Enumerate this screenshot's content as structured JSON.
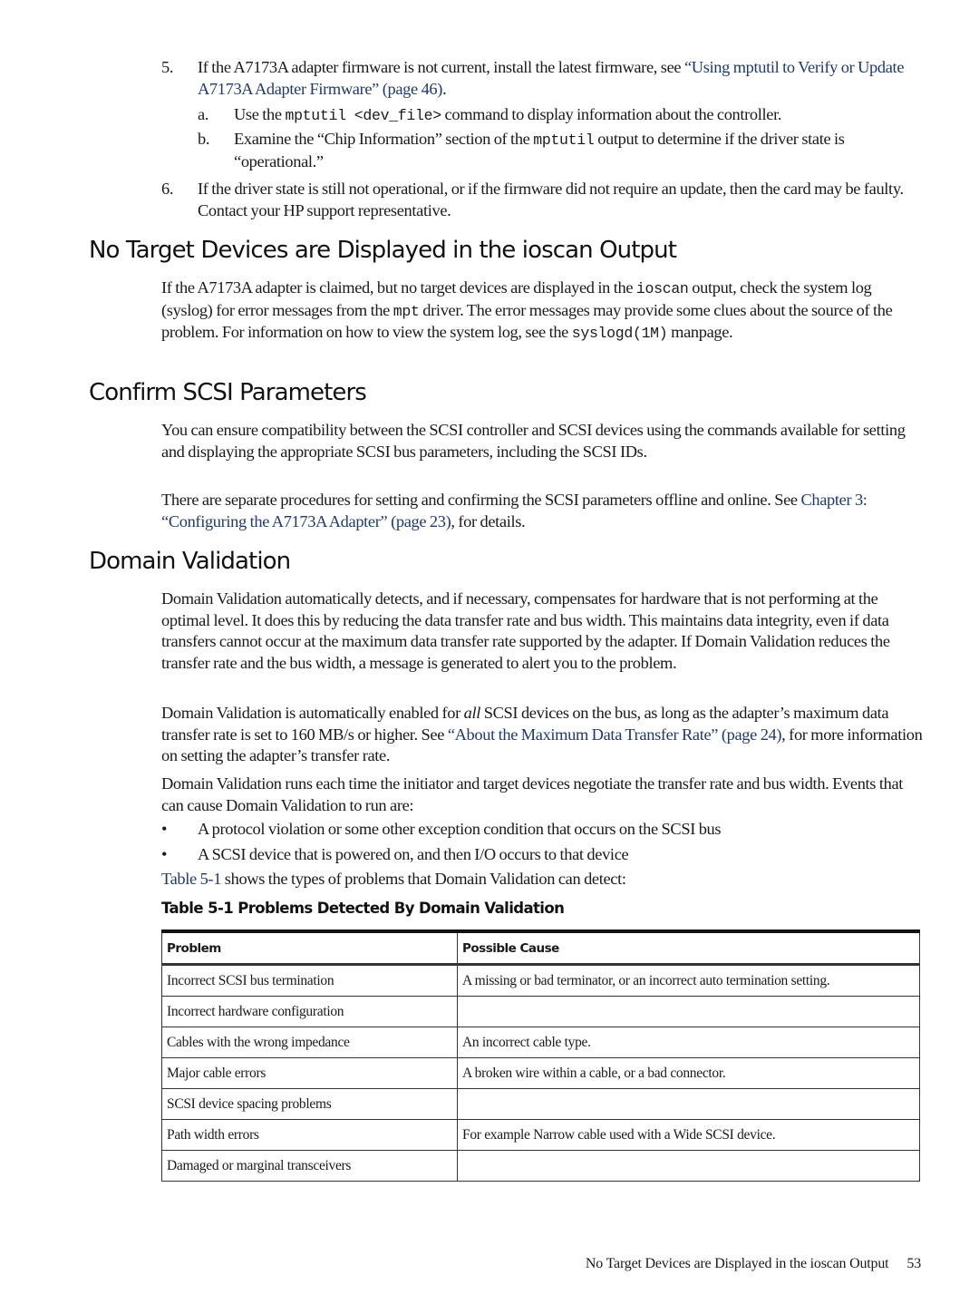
{
  "steps": [
    {
      "number": "5.",
      "text_before": "If the A7173A adapter firmware is not current, install the latest firmware, see ",
      "link": "“Using mptutil to Verify or Update A7173A Adapter Firmware” (page 46)",
      "text_after": ".",
      "substeps": [
        {
          "letter": "a.",
          "pre": "Use the ",
          "code": "mptutil <dev_file>",
          "post": " command to display information about the controller."
        },
        {
          "letter": "b.",
          "pre": "Examine the “Chip Information” section of the ",
          "code": "mptutil",
          "post": " output to determine if the driver state is “operational.”"
        }
      ]
    },
    {
      "number": "6.",
      "text": "If the driver state is still not operational, or if the firmware did not require an update, then the card may be faulty. Contact your HP support representative."
    }
  ],
  "sections": {
    "no_target": {
      "title": "No Target Devices are Displayed in the ioscan Output",
      "p1_a": "If the A7173A adapter is claimed, but no target devices are displayed in the ",
      "p1_code1": "ioscan",
      "p1_b": " output, check the system log (syslog) for error messages from the ",
      "p1_code2": "mpt",
      "p1_c": " driver. The error messages may provide some clues about the source of the problem. For information on how to view the system log, see the ",
      "p1_code3": "syslogd(1M)",
      "p1_d": " manpage."
    },
    "confirm_scsi": {
      "title": "Confirm SCSI Parameters",
      "p1": "You can ensure compatibility between the SCSI controller and SCSI devices using the commands available for setting and displaying the appropriate SCSI bus parameters, including the SCSI IDs.",
      "p2_a": "There are separate procedures for setting and confirming the SCSI parameters offline and online. See ",
      "p2_link": "Chapter 3: “Configuring the A7173A Adapter” (page 23)",
      "p2_b": ", for details."
    },
    "domain_validation": {
      "title": "Domain Validation",
      "p1": "Domain Validation automatically detects, and if necessary, compensates for hardware that is not performing at the optimal level. It does this by reducing the data transfer rate and bus width. This maintains data integrity, even if data transfers cannot occur at the maximum data transfer rate supported by the adapter. If Domain Validation reduces the transfer rate and the bus width, a message is generated to alert you to the problem.",
      "p2_a": "Domain Validation is automatically enabled for ",
      "p2_em": "all",
      "p2_b": " SCSI devices on the bus, as long as the adapter’s maximum data transfer rate is set to 160 MB/s or higher. See ",
      "p2_link": "“About the Maximum Data Transfer Rate” (page 24)",
      "p2_c": ", for more information on setting the adapter’s transfer rate.",
      "p3": "Domain Validation runs each time the initiator and target devices negotiate the transfer rate and bus width. Events that can cause Domain Validation to run are:",
      "bullets": [
        "A protocol violation or some other exception condition that occurs on the SCSI bus",
        "A SCSI device that is powered on, and then I/O occurs to that device"
      ],
      "bullet_glyph": "•",
      "p4_link": "Table 5-1",
      "p4_rest": " shows the types of problems that Domain Validation can detect:"
    }
  },
  "table": {
    "caption": "Table  5-1  Problems Detected By Domain Validation",
    "headers": [
      "Problem",
      "Possible Cause"
    ],
    "rows": [
      [
        "Incorrect SCSI bus termination",
        "A missing or bad terminator, or an incorrect auto termination setting."
      ],
      [
        "Incorrect hardware configuration",
        ""
      ],
      [
        "Cables with the wrong impedance",
        "An incorrect cable type."
      ],
      [
        "Major cable errors",
        "A broken wire within a cable, or a bad connector."
      ],
      [
        "SCSI device spacing problems",
        ""
      ],
      [
        "Path width errors",
        "For example Narrow cable used with a Wide SCSI device."
      ],
      [
        "Damaged or marginal transceivers",
        ""
      ]
    ]
  },
  "footer": {
    "running_title": "No Target Devices are Displayed in the ioscan Output",
    "page_number": "53"
  },
  "colors": {
    "link": "#1f3a6e",
    "text": "#1a1a1a"
  }
}
